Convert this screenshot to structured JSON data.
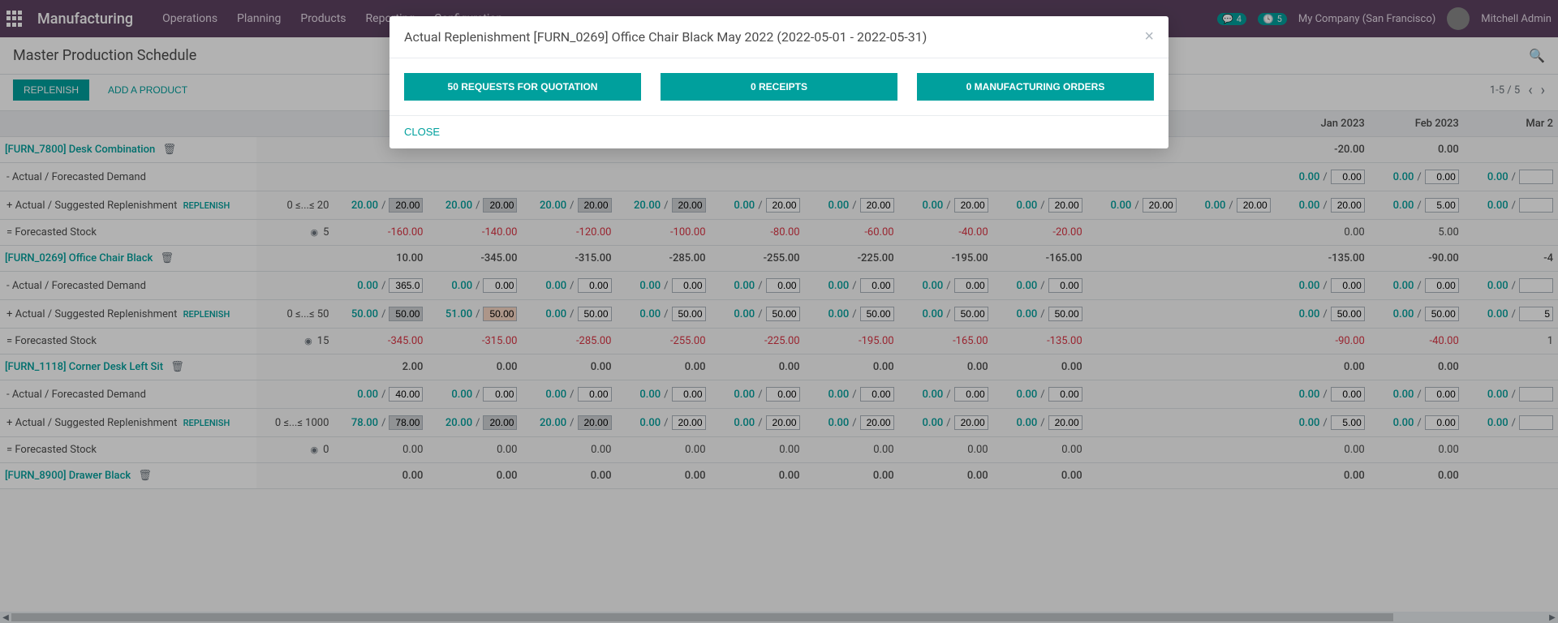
{
  "navbar": {
    "brand": "Manufacturing",
    "menu": [
      "Operations",
      "Planning",
      "Products",
      "Reporting",
      "Configuration"
    ],
    "badge1": "4",
    "badge2": "5",
    "company": "My Company (San Francisco)",
    "user": "Mitchell Admin"
  },
  "page": {
    "title": "Master Production Schedule",
    "replenish_btn": "Replenish",
    "add_product_btn": "Add a Product",
    "pager": "1-5 / 5"
  },
  "modal": {
    "title": "Actual Replenishment [FURN_0269] Office Chair Black May 2022 (2022-05-01 - 2022-05-31)",
    "rfq_btn": "50 REQUESTS FOR QUOTATION",
    "receipts_btn": "0 RECEIPTS",
    "mo_btn": "0 MANUFACTURING ORDERS",
    "close_btn": "CLOSE"
  },
  "table": {
    "months": [
      "",
      "",
      "",
      "",
      "",
      "",
      "",
      "",
      "",
      "",
      "Jan 2023",
      "Feb 2023",
      "Mar 2"
    ],
    "row_labels": {
      "demand": "- Actual / Forecasted Demand",
      "repl": "+ Actual / Suggested Replenishment",
      "repl_link": "REPLENISH",
      "stock": "= Forecasted Stock"
    },
    "products": [
      {
        "name": "[FURN_7800] Desk Combination",
        "summary": [
          "",
          "",
          "",
          "",
          "",
          "",
          "",
          "",
          "",
          "",
          "-20.00",
          "0.00",
          ""
        ],
        "demand": {
          "pairs": [
            {
              "v": "",
              "i": ""
            },
            {
              "v": "",
              "i": ""
            },
            {
              "v": "",
              "i": ""
            },
            {
              "v": "",
              "i": ""
            },
            {
              "v": "",
              "i": ""
            },
            {
              "v": "",
              "i": ""
            },
            {
              "v": "",
              "i": ""
            },
            {
              "v": "",
              "i": ""
            },
            {
              "v": "",
              "i": ""
            },
            {
              "v": "",
              "i": ""
            },
            {
              "v": "0.00",
              "i": "0.00"
            },
            {
              "v": "0.00",
              "i": "0.00"
            },
            {
              "v": "0.00",
              "i": ""
            }
          ]
        },
        "repl": {
          "range": "0 ≤...≤ 20",
          "pairs": [
            {
              "v": "20.00",
              "i": "20.00",
              "s": true
            },
            {
              "v": "20.00",
              "i": "20.00",
              "s": true
            },
            {
              "v": "20.00",
              "i": "20.00",
              "s": true
            },
            {
              "v": "20.00",
              "i": "20.00",
              "s": true
            },
            {
              "v": "0.00",
              "i": "20.00"
            },
            {
              "v": "0.00",
              "i": "20.00"
            },
            {
              "v": "0.00",
              "i": "20.00"
            },
            {
              "v": "0.00",
              "i": "20.00"
            },
            {
              "v": "0.00",
              "i": "20.00"
            },
            {
              "v": "0.00",
              "i": "20.00"
            },
            {
              "v": "0.00",
              "i": "20.00"
            },
            {
              "v": "0.00",
              "i": "5.00"
            },
            {
              "v": "0.00",
              "i": ""
            }
          ]
        },
        "stock": {
          "onhand": "5",
          "vals": [
            "-160.00",
            "-140.00",
            "-120.00",
            "-100.00",
            "-80.00",
            "-60.00",
            "-40.00",
            "-20.00",
            "",
            "",
            "0.00",
            "5.00",
            ""
          ]
        }
      },
      {
        "name": "[FURN_0269] Office Chair Black",
        "summary": [
          "10.00",
          "-345.00",
          "-315.00",
          "-285.00",
          "-255.00",
          "-225.00",
          "-195.00",
          "-165.00",
          "",
          "",
          "-135.00",
          "-90.00",
          "-4"
        ],
        "demand": {
          "pairs": [
            {
              "v": "0.00",
              "i": "365.0"
            },
            {
              "v": "0.00",
              "i": "0.00"
            },
            {
              "v": "0.00",
              "i": "0.00"
            },
            {
              "v": "0.00",
              "i": "0.00"
            },
            {
              "v": "0.00",
              "i": "0.00"
            },
            {
              "v": "0.00",
              "i": "0.00"
            },
            {
              "v": "0.00",
              "i": "0.00"
            },
            {
              "v": "0.00",
              "i": "0.00"
            },
            {
              "v": "",
              "i": ""
            },
            {
              "v": "",
              "i": ""
            },
            {
              "v": "0.00",
              "i": "0.00"
            },
            {
              "v": "0.00",
              "i": "0.00"
            },
            {
              "v": "0.00",
              "i": ""
            }
          ]
        },
        "repl": {
          "range": "0 ≤...≤ 50",
          "pairs": [
            {
              "v": "50.00",
              "i": "50.00",
              "s": true
            },
            {
              "v": "51.00",
              "i": "50.00",
              "o": true
            },
            {
              "v": "0.00",
              "i": "50.00"
            },
            {
              "v": "0.00",
              "i": "50.00"
            },
            {
              "v": "0.00",
              "i": "50.00"
            },
            {
              "v": "0.00",
              "i": "50.00"
            },
            {
              "v": "0.00",
              "i": "50.00"
            },
            {
              "v": "0.00",
              "i": "50.00"
            },
            {
              "v": "",
              "i": ""
            },
            {
              "v": "",
              "i": ""
            },
            {
              "v": "0.00",
              "i": "50.00"
            },
            {
              "v": "0.00",
              "i": "50.00"
            },
            {
              "v": "0.00",
              "i": "5"
            }
          ]
        },
        "stock": {
          "onhand": "15",
          "vals": [
            "-345.00",
            "-315.00",
            "-285.00",
            "-255.00",
            "-225.00",
            "-195.00",
            "-165.00",
            "-135.00",
            "",
            "",
            "-90.00",
            "-40.00",
            "1"
          ]
        }
      },
      {
        "name": "[FURN_1118] Corner Desk Left Sit",
        "summary": [
          "2.00",
          "0.00",
          "0.00",
          "0.00",
          "0.00",
          "0.00",
          "0.00",
          "0.00",
          "",
          "",
          "0.00",
          "0.00",
          ""
        ],
        "demand": {
          "pairs": [
            {
              "v": "0.00",
              "i": "40.00"
            },
            {
              "v": "0.00",
              "i": "0.00"
            },
            {
              "v": "0.00",
              "i": "0.00"
            },
            {
              "v": "0.00",
              "i": "0.00"
            },
            {
              "v": "0.00",
              "i": "0.00"
            },
            {
              "v": "0.00",
              "i": "0.00"
            },
            {
              "v": "0.00",
              "i": "0.00"
            },
            {
              "v": "0.00",
              "i": "0.00"
            },
            {
              "v": "",
              "i": ""
            },
            {
              "v": "",
              "i": ""
            },
            {
              "v": "0.00",
              "i": "0.00"
            },
            {
              "v": "0.00",
              "i": "0.00"
            },
            {
              "v": "0.00",
              "i": ""
            }
          ]
        },
        "repl": {
          "range": "0 ≤...≤ 1000",
          "pairs": [
            {
              "v": "78.00",
              "i": "78.00",
              "s": true
            },
            {
              "v": "20.00",
              "i": "20.00",
              "s": true
            },
            {
              "v": "20.00",
              "i": "20.00",
              "s": true
            },
            {
              "v": "0.00",
              "i": "20.00"
            },
            {
              "v": "0.00",
              "i": "20.00"
            },
            {
              "v": "0.00",
              "i": "20.00"
            },
            {
              "v": "0.00",
              "i": "20.00"
            },
            {
              "v": "0.00",
              "i": "20.00"
            },
            {
              "v": "",
              "i": ""
            },
            {
              "v": "",
              "i": ""
            },
            {
              "v": "0.00",
              "i": "5.00"
            },
            {
              "v": "0.00",
              "i": "0.00"
            },
            {
              "v": "0.00",
              "i": ""
            }
          ]
        },
        "stock": {
          "onhand": "0",
          "vals": [
            "0.00",
            "0.00",
            "0.00",
            "0.00",
            "0.00",
            "0.00",
            "0.00",
            "0.00",
            "",
            "",
            "0.00",
            "0.00",
            ""
          ]
        }
      },
      {
        "name": "[FURN_8900] Drawer Black",
        "summary": [
          "0.00",
          "0.00",
          "0.00",
          "0.00",
          "0.00",
          "0.00",
          "0.00",
          "0.00",
          "",
          "",
          "0.00",
          "0.00",
          ""
        ]
      }
    ]
  }
}
